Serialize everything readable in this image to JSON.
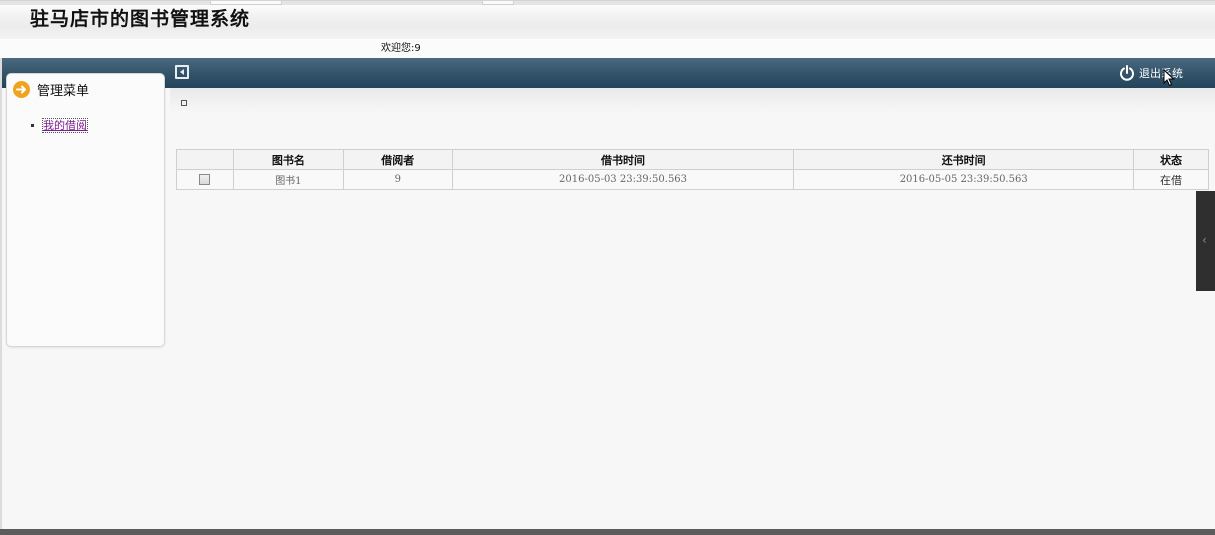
{
  "header": {
    "app_title": "驻马店市的图书管理系统",
    "welcome_text": "欢迎您:9"
  },
  "nav": {
    "logout_label": "退出系统"
  },
  "sidebar": {
    "title": "管理菜单",
    "items": [
      {
        "label": "我的借阅"
      }
    ]
  },
  "table": {
    "columns": [
      "",
      "图书名",
      "借阅者",
      "借书时间",
      "还书时间",
      "状态"
    ],
    "rows": [
      {
        "book_name": "图书1",
        "borrower": "9",
        "borrow_time": "2016-05-03 23:39:50.563",
        "return_time": "2016-05-05 23:39:50.563",
        "status": "在借"
      }
    ]
  },
  "colors": {
    "nav_bar": "#34546b",
    "accent_arrow": "#f2a31d",
    "link": "#7a1f8e"
  }
}
